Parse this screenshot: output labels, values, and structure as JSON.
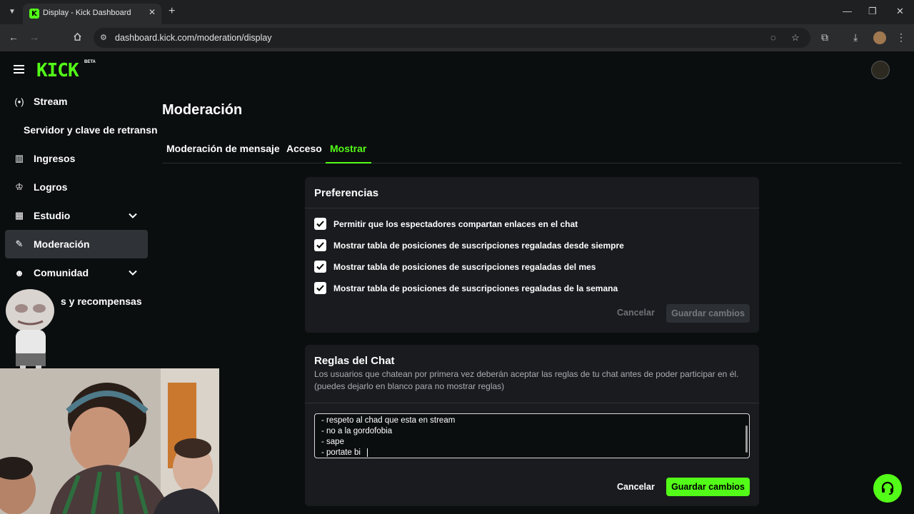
{
  "browser": {
    "tab_title": "Display - Kick Dashboard",
    "url": "dashboard.kick.com/moderation/display"
  },
  "app": {
    "logo": "KICK",
    "logo_badge": "BETA"
  },
  "sidebar": {
    "items": [
      {
        "label": "Stream",
        "icon": "broadcast-icon"
      },
      {
        "label": "Servidor y clave de retransn",
        "sub": true
      },
      {
        "label": "Ingresos",
        "icon": "chart-icon"
      },
      {
        "label": "Logros",
        "icon": "trophy-icon"
      },
      {
        "label": "Estudio",
        "icon": "studio-icon",
        "expandable": true
      },
      {
        "label": "Moderación",
        "icon": "wrench-icon",
        "active": true
      },
      {
        "label": "Comunidad",
        "icon": "community-icon",
        "expandable": true
      },
      {
        "label": "s y recompensas"
      }
    ]
  },
  "main": {
    "title": "Moderación",
    "tabs": [
      {
        "label": "Moderación de mensaje"
      },
      {
        "label": "Acceso"
      },
      {
        "label": "Mostrar",
        "active": true
      }
    ]
  },
  "preferences": {
    "title": "Preferencias",
    "options": [
      {
        "label": "Permitir que los espectadores compartan enlaces en el chat",
        "checked": true
      },
      {
        "label": "Mostrar tabla de posiciones de suscripciones regaladas desde siempre",
        "checked": true
      },
      {
        "label": "Mostrar tabla de posiciones de suscripciones regaladas del mes",
        "checked": true
      },
      {
        "label": "Mostrar tabla de posiciones de suscripciones regaladas de la semana",
        "checked": true
      }
    ],
    "cancel_label": "Cancelar",
    "save_label": "Guardar cambios"
  },
  "chat_rules": {
    "title": "Reglas del Chat",
    "description": "Los usuarios que chatean por primera vez deberán aceptar las reglas de tu chat antes de poder participar en él. (puedes dejarlo en blanco para no mostrar reglas)",
    "lines": [
      "- respeto al chad que esta en stream",
      "- no a la gordofobia",
      "- sape",
      "- portate bi"
    ],
    "cancel_label": "Cancelar",
    "save_label": "Guardar cambios"
  },
  "colors": {
    "accent": "#53fc18",
    "background": "#0b0e0f",
    "card": "#191b1f"
  }
}
